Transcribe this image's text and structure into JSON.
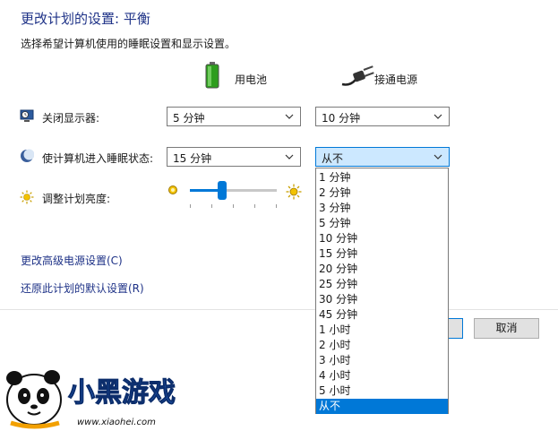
{
  "header": {
    "title": "更改计划的设置: 平衡",
    "subtitle": "选择希望计算机使用的睡眠设置和显示设置。"
  },
  "columns": {
    "battery_label": "用电池",
    "plugged_label": "接通电源"
  },
  "settings": {
    "display_off_label": "关闭显示器:",
    "display_off_battery": "5 分钟",
    "display_off_plugged": "10 分钟",
    "sleep_label": "使计算机进入睡眠状态:",
    "sleep_battery": "15 分钟",
    "sleep_plugged": "从不",
    "brightness_label": "调整计划亮度:",
    "brightness_level": 0.37
  },
  "dropdown_options": [
    "1 分钟",
    "2 分钟",
    "3 分钟",
    "5 分钟",
    "10 分钟",
    "15 分钟",
    "20 分钟",
    "25 分钟",
    "30 分钟",
    "45 分钟",
    "1 小时",
    "2 小时",
    "3 小时",
    "4 小时",
    "5 小时",
    "从不"
  ],
  "dropdown_selected": "从不",
  "links": {
    "advanced": "更改高级电源设置(C)",
    "restore": "还原此计划的默认设置(R)"
  },
  "buttons": {
    "cancel": "取消"
  },
  "watermark": {
    "text": "小黑游戏",
    "url": "www.xiaohei.com"
  },
  "colors": {
    "accent": "#0078d7",
    "link": "#1e3287",
    "selected_item_bg": "#0078d7",
    "open_select_bg": "#cce8ff"
  }
}
